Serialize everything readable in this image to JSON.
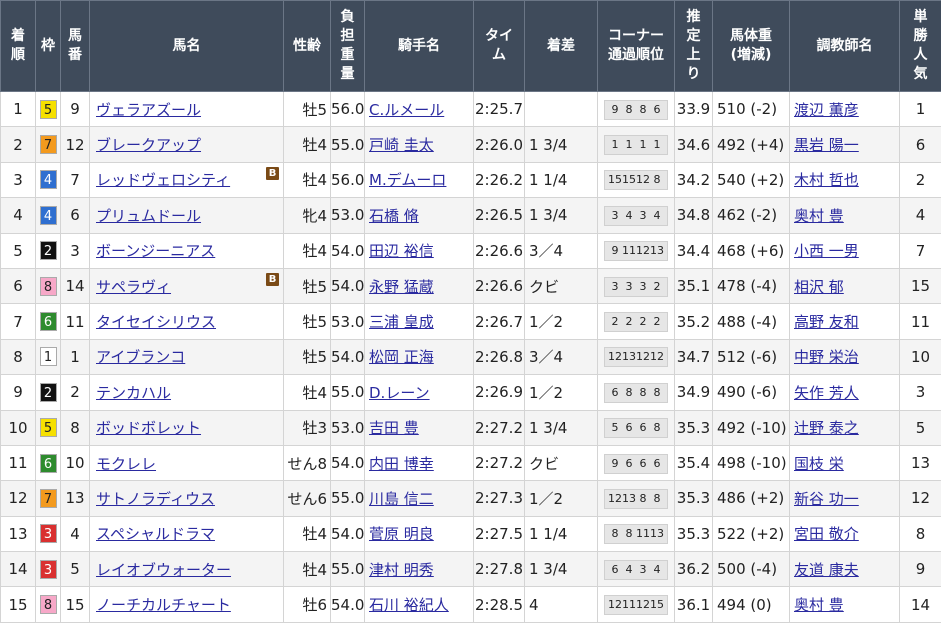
{
  "headers": {
    "rank": "着順",
    "waku": "枠",
    "umaban": "馬番",
    "horse": "馬名",
    "sexage": "性齢",
    "weight": "負担重量",
    "jockey": "騎手名",
    "time": "タイム",
    "margin": "着差",
    "corner": "コーナー通過順位",
    "last3f": "推定上り",
    "body": "馬体重(増減)",
    "trainer": "調教師名",
    "pop": "単勝人気"
  },
  "waku_colors": {
    "1": {
      "bg": "#ffffff",
      "fg": "#222222"
    },
    "2": {
      "bg": "#111111",
      "fg": "#ffffff"
    },
    "3": {
      "bg": "#d93030",
      "fg": "#ffffff"
    },
    "4": {
      "bg": "#2f6fd0",
      "fg": "#ffffff"
    },
    "5": {
      "bg": "#f6e000",
      "fg": "#222222"
    },
    "6": {
      "bg": "#2e8b2e",
      "fg": "#ffffff"
    },
    "7": {
      "bg": "#f39a1e",
      "fg": "#222222"
    },
    "8": {
      "bg": "#f7a8c8",
      "fg": "#222222"
    }
  },
  "rows": [
    {
      "rank": "1",
      "waku": "5",
      "umaban": "9",
      "horse": "ヴェラアズール",
      "blinker": "",
      "sexage": "牡5",
      "weight": "56.0",
      "jockey": "C.ルメール",
      "time": "2:25.7",
      "margin": "",
      "corner": [
        "9",
        "8",
        "8",
        "6"
      ],
      "last3f": "33.9",
      "body": "510 (-2)",
      "trainer": "渡辺 薫彦",
      "pop": "1"
    },
    {
      "rank": "2",
      "waku": "7",
      "umaban": "12",
      "horse": "ブレークアップ",
      "blinker": "",
      "sexage": "牡4",
      "weight": "55.0",
      "jockey": "戸崎 圭太",
      "time": "2:26.0",
      "margin": "1 3/4",
      "corner": [
        "1",
        "1",
        "1",
        "1"
      ],
      "last3f": "34.6",
      "body": "492 (+4)",
      "trainer": "黒岩 陽一",
      "pop": "6"
    },
    {
      "rank": "3",
      "waku": "4",
      "umaban": "7",
      "horse": "レッドヴェロシティ",
      "blinker": "B",
      "sexage": "牡4",
      "weight": "56.0",
      "jockey": "M.デムーロ",
      "time": "2:26.2",
      "margin": "1 1/4",
      "corner": [
        "15",
        "15",
        "12",
        "8"
      ],
      "last3f": "34.2",
      "body": "540 (+2)",
      "trainer": "木村 哲也",
      "pop": "2"
    },
    {
      "rank": "4",
      "waku": "4",
      "umaban": "6",
      "horse": "プリュムドール",
      "blinker": "",
      "sexage": "牝4",
      "weight": "53.0",
      "jockey": "石橋 脩",
      "time": "2:26.5",
      "margin": "1 3/4",
      "corner": [
        "3",
        "4",
        "3",
        "4"
      ],
      "last3f": "34.8",
      "body": "462 (-2)",
      "trainer": "奥村 豊",
      "pop": "4"
    },
    {
      "rank": "5",
      "waku": "2",
      "umaban": "3",
      "horse": "ボーンジーニアス",
      "blinker": "",
      "sexage": "牡4",
      "weight": "54.0",
      "jockey": "田辺 裕信",
      "time": "2:26.6",
      "margin": "3／4",
      "corner": [
        "9",
        "11",
        "12",
        "13"
      ],
      "last3f": "34.4",
      "body": "468 (+6)",
      "trainer": "小西 一男",
      "pop": "7"
    },
    {
      "rank": "6",
      "waku": "8",
      "umaban": "14",
      "horse": "サペラヴィ",
      "blinker": "B",
      "sexage": "牡5",
      "weight": "54.0",
      "jockey": "永野 猛蔵",
      "time": "2:26.6",
      "margin": "クビ",
      "corner": [
        "3",
        "3",
        "3",
        "2"
      ],
      "last3f": "35.1",
      "body": "478 (-4)",
      "trainer": "相沢 郁",
      "pop": "15"
    },
    {
      "rank": "7",
      "waku": "6",
      "umaban": "11",
      "horse": "タイセイシリウス",
      "blinker": "",
      "sexage": "牡5",
      "weight": "53.0",
      "jockey": "三浦 皇成",
      "time": "2:26.7",
      "margin": "1／2",
      "corner": [
        "2",
        "2",
        "2",
        "2"
      ],
      "last3f": "35.2",
      "body": "488 (-4)",
      "trainer": "高野 友和",
      "pop": "11"
    },
    {
      "rank": "8",
      "waku": "1",
      "umaban": "1",
      "horse": "アイブランコ",
      "blinker": "",
      "sexage": "牡5",
      "weight": "54.0",
      "jockey": "松岡 正海",
      "time": "2:26.8",
      "margin": "3／4",
      "corner": [
        "12",
        "13",
        "12",
        "12"
      ],
      "last3f": "34.7",
      "body": "512 (-6)",
      "trainer": "中野 栄治",
      "pop": "10"
    },
    {
      "rank": "9",
      "waku": "2",
      "umaban": "2",
      "horse": "テンカハル",
      "blinker": "",
      "sexage": "牡4",
      "weight": "55.0",
      "jockey": "D.レーン",
      "time": "2:26.9",
      "margin": "1／2",
      "corner": [
        "6",
        "8",
        "8",
        "8"
      ],
      "last3f": "34.9",
      "body": "490 (-6)",
      "trainer": "矢作 芳人",
      "pop": "3"
    },
    {
      "rank": "10",
      "waku": "5",
      "umaban": "8",
      "horse": "ボッドボレット",
      "blinker": "",
      "sexage": "牡3",
      "weight": "53.0",
      "jockey": "吉田 豊",
      "time": "2:27.2",
      "margin": "1 3/4",
      "corner": [
        "5",
        "6",
        "6",
        "8"
      ],
      "last3f": "35.3",
      "body": "492 (-10)",
      "trainer": "辻野 泰之",
      "pop": "5"
    },
    {
      "rank": "11",
      "waku": "6",
      "umaban": "10",
      "horse": "モクレレ",
      "blinker": "",
      "sexage": "せん8",
      "weight": "54.0",
      "jockey": "内田 博幸",
      "time": "2:27.2",
      "margin": "クビ",
      "corner": [
        "9",
        "6",
        "6",
        "6"
      ],
      "last3f": "35.4",
      "body": "498 (-10)",
      "trainer": "国枝 栄",
      "pop": "13"
    },
    {
      "rank": "12",
      "waku": "7",
      "umaban": "13",
      "horse": "サトノラディウス",
      "blinker": "",
      "sexage": "せん6",
      "weight": "55.0",
      "jockey": "川島 信二",
      "time": "2:27.3",
      "margin": "1／2",
      "corner": [
        "12",
        "13",
        "8",
        "8"
      ],
      "last3f": "35.3",
      "body": "486 (+2)",
      "trainer": "新谷 功一",
      "pop": "12"
    },
    {
      "rank": "13",
      "waku": "3",
      "umaban": "4",
      "horse": "スペシャルドラマ",
      "blinker": "",
      "sexage": "牡4",
      "weight": "54.0",
      "jockey": "菅原 明良",
      "time": "2:27.5",
      "margin": "1 1/4",
      "corner": [
        "8",
        "8",
        "11",
        "13"
      ],
      "last3f": "35.3",
      "body": "522 (+2)",
      "trainer": "宮田 敬介",
      "pop": "8"
    },
    {
      "rank": "14",
      "waku": "3",
      "umaban": "5",
      "horse": "レイオブウォーター",
      "blinker": "",
      "sexage": "牡4",
      "weight": "55.0",
      "jockey": "津村 明秀",
      "time": "2:27.8",
      "margin": "1 3/4",
      "corner": [
        "6",
        "4",
        "3",
        "4"
      ],
      "last3f": "36.2",
      "body": "500 (-4)",
      "trainer": "友道 康夫",
      "pop": "9"
    },
    {
      "rank": "15",
      "waku": "8",
      "umaban": "15",
      "horse": "ノーチカルチャート",
      "blinker": "",
      "sexage": "牡6",
      "weight": "54.0",
      "jockey": "石川 裕紀人",
      "time": "2:28.5",
      "margin": "4",
      "corner": [
        "12",
        "11",
        "12",
        "15"
      ],
      "last3f": "36.1",
      "body": "494 (0)",
      "trainer": "奥村 豊",
      "pop": "14"
    }
  ]
}
